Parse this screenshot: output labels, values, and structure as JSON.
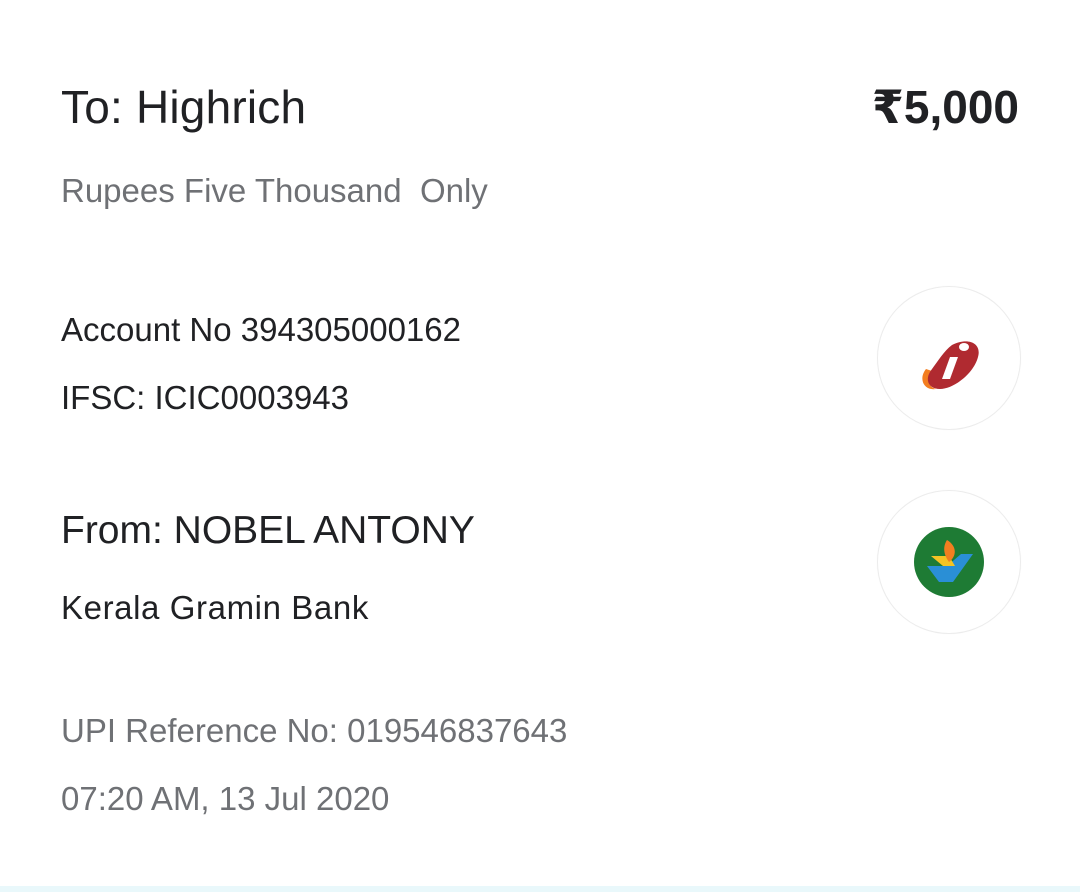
{
  "payee": {
    "to_label": "To: Highrich",
    "amount": "₹5,000",
    "amount_in_words": "Rupees Five Thousand  Only",
    "account_number": "Account No 394305000162",
    "ifsc": "IFSC: ICIC0003943",
    "bank_icon": "icici-bank-logo-icon"
  },
  "payer": {
    "from_label": "From: NOBEL ANTONY",
    "bank_name": "Kerala Gramin Bank",
    "bank_icon": "kerala-gramin-bank-logo-icon"
  },
  "transaction": {
    "upi_reference": "UPI Reference No: 019546837643",
    "timestamp": "07:20 AM, 13 Jul 2020"
  },
  "colors": {
    "primary_text": "#202124",
    "secondary_text": "#6f7175",
    "icici_red": "#b02a30",
    "icici_orange": "#f37e20",
    "kgb_green": "#1e7b34",
    "kgb_yellow": "#f6c324",
    "kgb_blue": "#2a8fd6"
  }
}
